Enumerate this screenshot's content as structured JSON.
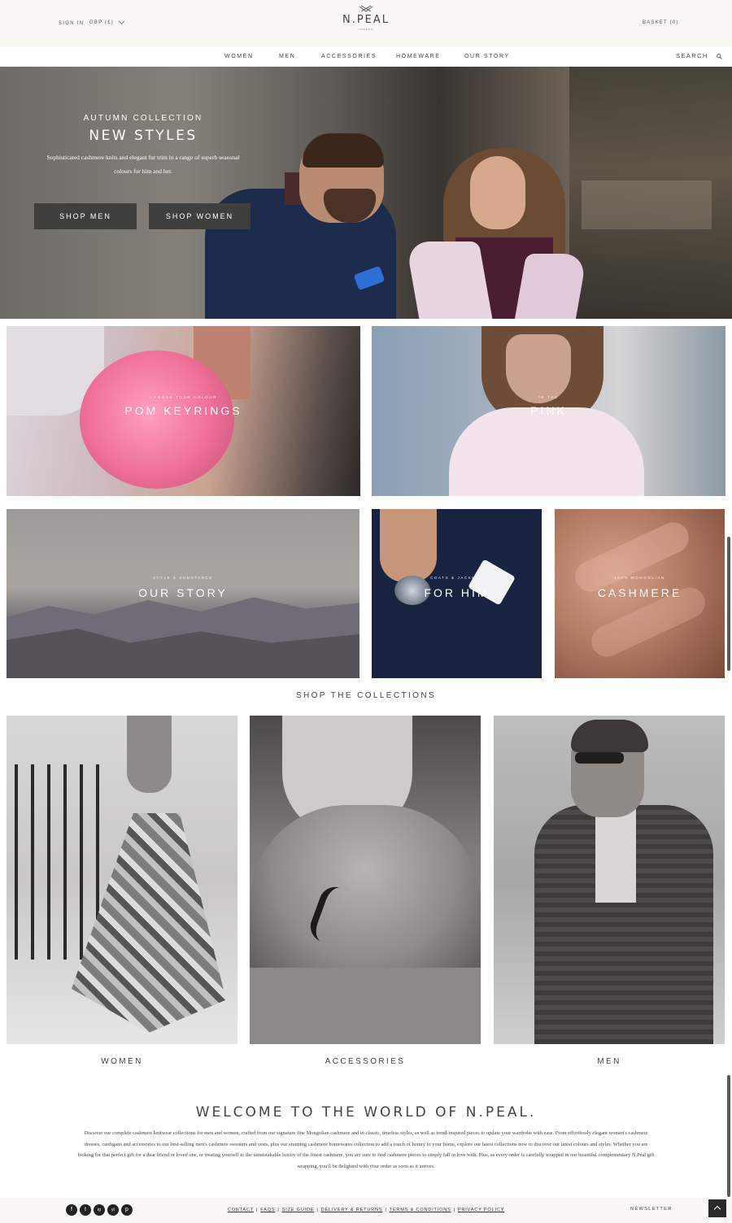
{
  "header": {
    "sign_in": "SIGN IN",
    "currency": "GBP (£)",
    "logo": "N.PEAL",
    "logo_sub": "LONDON",
    "basket": "BASKET (0)"
  },
  "nav": {
    "items": [
      "WOMEN",
      "MEN",
      "ACCESSORIES",
      "HOMEWARE",
      "OUR STORY"
    ],
    "search": "SEARCH"
  },
  "hero": {
    "kicker": "AUTUMN COLLECTION",
    "title": "NEW STYLES",
    "description": "Sophisticated cashmere knits and elegant fur trim in a range of superb seasonal colours for him and her.",
    "shop_men": "SHOP MEN",
    "shop_women": "SHOP WOMEN"
  },
  "promos": [
    {
      "kicker": "CHOOSE YOUR COLOUR",
      "title": "POM KEYRINGS"
    },
    {
      "kicker": "IN THE",
      "title": "PINK"
    },
    {
      "kicker": "STYLE & SUBSTANCE",
      "title": "OUR STORY"
    },
    {
      "kicker": "COATS & JACKETS",
      "title": "FOR HIM"
    },
    {
      "kicker": "100% MONGOLIAN",
      "title": "CASHMERE"
    }
  ],
  "collections": {
    "title": "SHOP THE COLLECTIONS",
    "items": [
      "WOMEN",
      "ACCESSORIES",
      "MEN"
    ]
  },
  "welcome": {
    "title": "WELCOME TO THE WORLD OF N.PEAL.",
    "body": "Discover our complete cashmere knitwear collections for men and women, crafted from our signature fine Mongolian cashmere and in classic, timeless styles, as well as trend-inspired pieces to update your wardrobe with ease. From effortlessly elegant women's cashmere dresses, cardigans and accessories to our best-selling men's cashmere sweaters and vests, plus our stunning cashmere homewares collection to add a touch of luxury to your home, explore our latest collections now to discover our latest colours and styles. Whether you are looking for that perfect gift for a dear friend or loved one, or treating yourself to the unmistakable luxury of the finest cashmere, you are sure to find cashmere pieces to simply fall in love with. Plus, as every order is carefully wrapped in our beautiful complementary N.Peal gift wrapping, you'll be delighted with your order as soon as it arrives."
  },
  "footer": {
    "social": [
      "f",
      "t",
      "ig",
      "yt",
      "p"
    ],
    "links": [
      "CONTACT",
      "FAQS",
      "SIZE GUIDE",
      "DELIVERY & RETURNS",
      "TERMS & CONDITIONS",
      "PRIVACY POLICY"
    ],
    "separator": "|",
    "newsletter": "NEWSLETTER"
  }
}
